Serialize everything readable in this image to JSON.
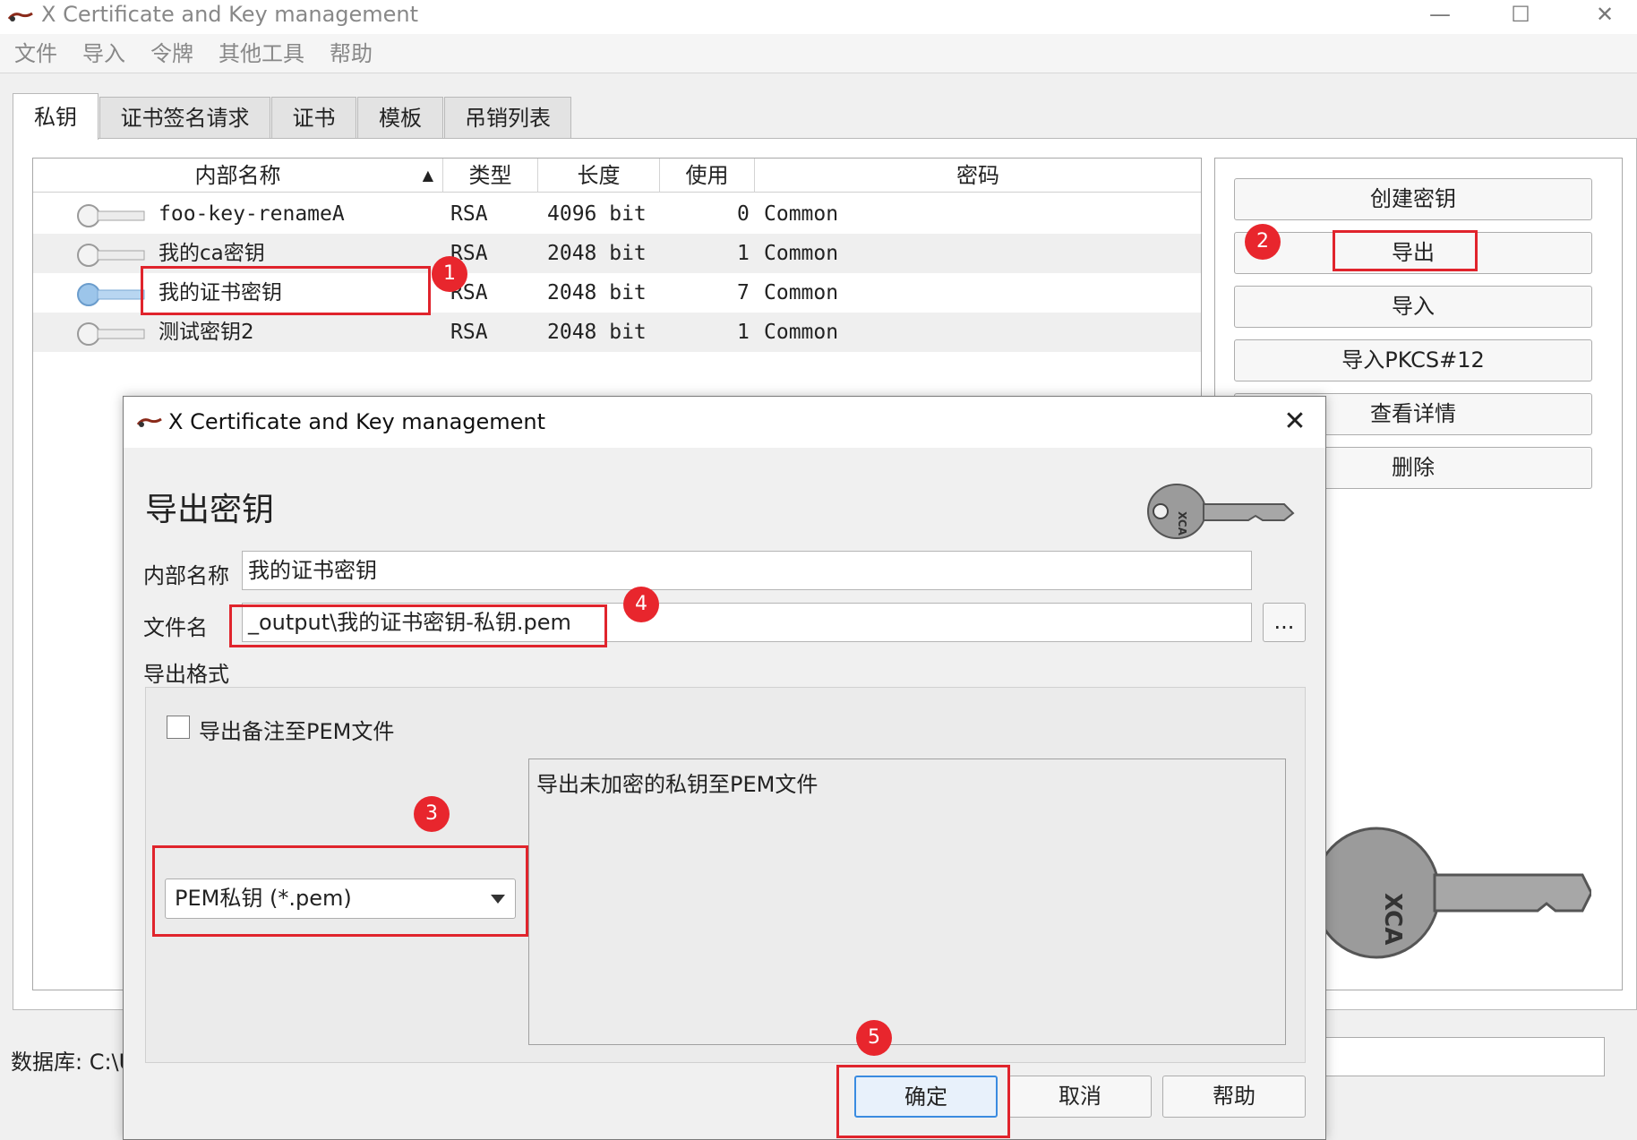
{
  "window": {
    "title": "X Certificate and Key management",
    "controls": {
      "minimize": "—",
      "maximize": "☐",
      "close": "✕"
    }
  },
  "menu": [
    "文件",
    "导入",
    "令牌",
    "其他工具",
    "帮助"
  ],
  "tabs": [
    "私钥",
    "证书签名请求",
    "证书",
    "模板",
    "吊销列表"
  ],
  "table": {
    "columns": [
      "内部名称",
      "类型",
      "长度",
      "使用",
      "密码"
    ],
    "sort_indicator": "▲",
    "rows": [
      {
        "name": "foo-key-renameA",
        "type": "RSA",
        "size": "4096 bit",
        "use": "0",
        "password": "Common"
      },
      {
        "name": "我的ca密钥",
        "type": "RSA",
        "size": "2048 bit",
        "use": "1",
        "password": "Common"
      },
      {
        "name": "我的证书密钥",
        "type": "RSA",
        "size": "2048 bit",
        "use": "7",
        "password": "Common"
      },
      {
        "name": "测试密钥2",
        "type": "RSA",
        "size": "2048 bit",
        "use": "1",
        "password": "Common"
      }
    ]
  },
  "side_buttons": [
    "创建密钥",
    "导出",
    "导入",
    "导入PKCS#12",
    "查看详情",
    "删除"
  ],
  "status": {
    "database_label": "数据库: C:\\U"
  },
  "dialog": {
    "title": "X Certificate and Key management",
    "close": "✕",
    "heading": "导出密钥",
    "logo_text": "XCA",
    "internal_name_label": "内部名称",
    "internal_name_value": "我的证书密钥",
    "filename_label": "文件名",
    "filename_value": "_output\\我的证书密钥-私钥.pem",
    "browse_label": "...",
    "format_label": "导出格式",
    "checkbox_label": "导出备注至PEM文件",
    "format_selected": "PEM私钥 (*.pem)",
    "description": "导出未加密的私钥至PEM文件",
    "buttons": {
      "ok": "确定",
      "cancel": "取消",
      "help": "帮助"
    }
  },
  "callouts": [
    "1",
    "2",
    "3",
    "4",
    "5"
  ],
  "colors": {
    "highlight": "#e0242c",
    "badge": "#e8262d",
    "selected_key_icon": "#9cc5ea"
  }
}
